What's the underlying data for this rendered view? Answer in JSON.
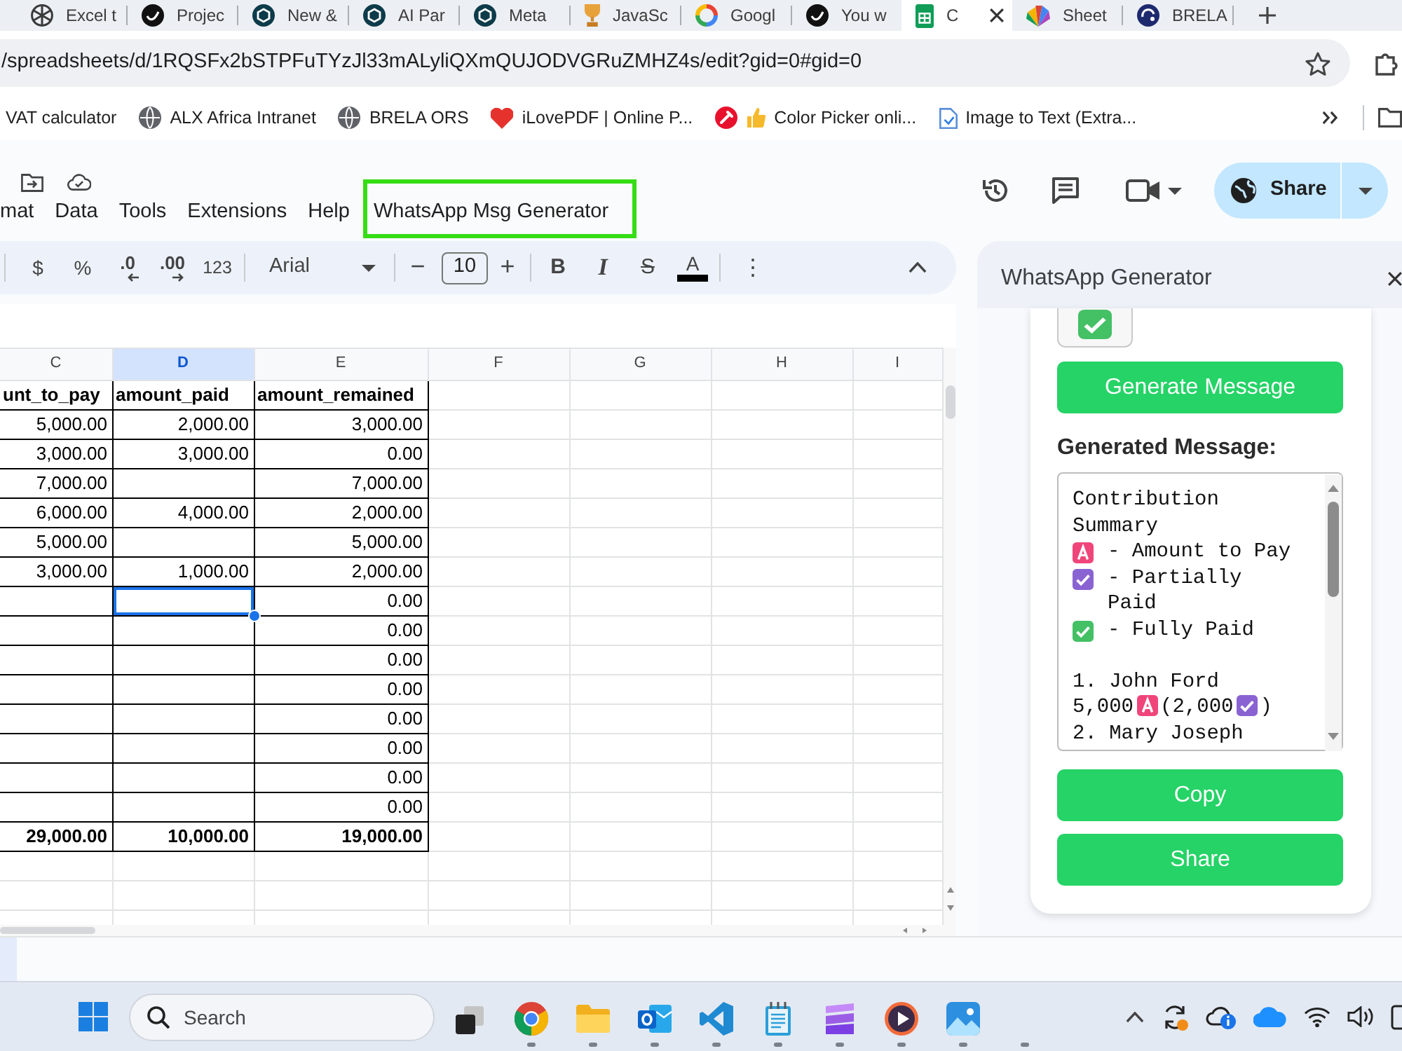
{
  "browser": {
    "tabs": [
      {
        "title": "Excel t",
        "kind": "knot",
        "selected": false
      },
      {
        "title": "Projec",
        "kind": "disc",
        "selected": false
      },
      {
        "title": "New &",
        "kind": "hexagon",
        "selected": false
      },
      {
        "title": "AI Par",
        "kind": "hexagon",
        "selected": false
      },
      {
        "title": "Meta",
        "kind": "hexagon",
        "selected": false
      },
      {
        "title": "JavaSc",
        "kind": "figure",
        "selected": false
      },
      {
        "title": "Googl",
        "kind": "ring",
        "selected": false
      },
      {
        "title": "You w",
        "kind": "disc",
        "selected": false
      },
      {
        "title": "C",
        "kind": "grid",
        "selected": true
      },
      {
        "title": "Sheet",
        "kind": "fan",
        "selected": false
      },
      {
        "title": "BRELA",
        "kind": "seal",
        "selected": false
      }
    ],
    "address": "/spreadsheets/d/1RQSFx2bSTPFuTYzJl33mALyliQXmQUJODVGRuZMHZ4s/edit?gid=0#gid=0",
    "bookmarks": [
      {
        "label": "VAT calculator"
      },
      {
        "label": "ALX Africa Intranet",
        "kind": "globe"
      },
      {
        "label": "BRELA ORS",
        "kind": "globe"
      },
      {
        "label": "iLovePDF | Online P...",
        "kind": "heart"
      },
      {
        "label": "Color Picker onli...",
        "kind": "picker"
      },
      {
        "label": "Image to Text (Extra...",
        "kind": "page"
      }
    ]
  },
  "sheets": {
    "menu": [
      {
        "label": "mat",
        "outlined": false
      },
      {
        "label": "Data",
        "outlined": false
      },
      {
        "label": "Tools",
        "outlined": false
      },
      {
        "label": "Extensions",
        "outlined": false
      },
      {
        "label": "Help",
        "outlined": false
      },
      {
        "label": "WhatsApp Msg Generator",
        "outlined": true
      }
    ],
    "share": "Share",
    "toolbar": {
      "currency": "$",
      "percent": "%",
      "decrease_decimals": ".0",
      "increase_decimals": ".00",
      "number_format": "123",
      "font": "Arial",
      "size_minus": "−",
      "font_size": "10",
      "size_plus": "+",
      "bold": "B",
      "italic": "I",
      "strikethrough": "S",
      "text_color": "A",
      "more": "⋮"
    },
    "columns": [
      {
        "label": "C",
        "selected": false
      },
      {
        "label": "D",
        "selected": true
      },
      {
        "label": "E",
        "selected": false
      },
      {
        "label": "F",
        "selected": false
      },
      {
        "label": "G",
        "selected": false
      },
      {
        "label": "H",
        "selected": false
      },
      {
        "label": "I",
        "selected": false
      }
    ],
    "rows": [
      {
        "kind": "header",
        "cells": [
          {
            "text": "unt_to_pay",
            "selected": false
          },
          {
            "text": "amount_paid",
            "selected": false
          },
          {
            "text": "amount_remained",
            "selected": false
          }
        ]
      },
      {
        "kind": "data",
        "cells": [
          {
            "text": "5,000.00",
            "selected": false
          },
          {
            "text": "2,000.00",
            "selected": false
          },
          {
            "text": "3,000.00",
            "selected": false
          }
        ]
      },
      {
        "kind": "data",
        "cells": [
          {
            "text": "3,000.00",
            "selected": false
          },
          {
            "text": "3,000.00",
            "selected": false
          },
          {
            "text": "0.00",
            "selected": false
          }
        ]
      },
      {
        "kind": "data",
        "cells": [
          {
            "text": "7,000.00",
            "selected": false
          },
          {
            "selected": false
          },
          {
            "text": "7,000.00",
            "selected": false
          }
        ]
      },
      {
        "kind": "data",
        "cells": [
          {
            "text": "6,000.00",
            "selected": false
          },
          {
            "text": "4,000.00",
            "selected": false
          },
          {
            "text": "2,000.00",
            "selected": false
          }
        ]
      },
      {
        "kind": "data",
        "cells": [
          {
            "text": "5,000.00",
            "selected": false
          },
          {
            "selected": false
          },
          {
            "text": "5,000.00",
            "selected": false
          }
        ]
      },
      {
        "kind": "data",
        "cells": [
          {
            "text": "3,000.00",
            "selected": false
          },
          {
            "text": "1,000.00",
            "selected": false
          },
          {
            "text": "2,000.00",
            "selected": false
          }
        ]
      },
      {
        "kind": "data",
        "cells": [
          {
            "selected": false
          },
          {
            "selected": true
          },
          {
            "text": "0.00",
            "selected": false
          }
        ]
      },
      {
        "kind": "data",
        "cells": [
          {
            "selected": false
          },
          {
            "selected": false
          },
          {
            "text": "0.00",
            "selected": false
          }
        ]
      },
      {
        "kind": "data",
        "cells": [
          {
            "selected": false
          },
          {
            "selected": false
          },
          {
            "text": "0.00",
            "selected": false
          }
        ]
      },
      {
        "kind": "data",
        "cells": [
          {
            "selected": false
          },
          {
            "selected": false
          },
          {
            "text": "0.00",
            "selected": false
          }
        ]
      },
      {
        "kind": "data",
        "cells": [
          {
            "selected": false
          },
          {
            "selected": false
          },
          {
            "text": "0.00",
            "selected": false
          }
        ]
      },
      {
        "kind": "data",
        "cells": [
          {
            "selected": false
          },
          {
            "selected": false
          },
          {
            "text": "0.00",
            "selected": false
          }
        ]
      },
      {
        "kind": "data",
        "cells": [
          {
            "selected": false
          },
          {
            "selected": false
          },
          {
            "text": "0.00",
            "selected": false
          }
        ]
      },
      {
        "kind": "data",
        "cells": [
          {
            "selected": false
          },
          {
            "selected": false
          },
          {
            "text": "0.00",
            "selected": false
          }
        ]
      },
      {
        "kind": "total",
        "cells": [
          {
            "text": "29,000.00",
            "selected": false
          },
          {
            "text": "10,000.00",
            "selected": false
          },
          {
            "text": "19,000.00",
            "selected": false
          }
        ]
      }
    ]
  },
  "sidebar": {
    "title": "WhatsApp Generator",
    "generate": "Generate Message",
    "output_label": "Generated Message:",
    "message": {
      "title": "Contribution Summary",
      "legend": [
        {
          "kind": "to_pay",
          "label": "- Amount to Pay"
        },
        {
          "kind": "partial",
          "label": "- Partially Paid"
        },
        {
          "kind": "paid",
          "label": "- Fully Paid"
        }
      ],
      "entries": [
        {
          "name": "1. John Ford",
          "segments": [
            {
              "kind": "text",
              "text": "5,000"
            },
            {
              "kind": "to_pay"
            },
            {
              "kind": "text",
              "text": "(2,000"
            },
            {
              "kind": "partial"
            },
            {
              "kind": "text",
              "text": ")"
            }
          ]
        },
        {
          "name": "2. Mary Joseph"
        }
      ]
    },
    "copy": "Copy",
    "share": "Share"
  },
  "taskbar": {
    "search": {
      "placeholder": "Search"
    },
    "apps": [
      {
        "kind": "wheel",
        "running": true
      },
      {
        "kind": "folder",
        "running": true
      },
      {
        "kind": "mail",
        "running": true
      },
      {
        "kind": "bracket",
        "running": true
      },
      {
        "kind": "notepad",
        "running": true
      },
      {
        "kind": "stack",
        "running": true
      },
      {
        "kind": "play",
        "running": true
      },
      {
        "kind": "picture",
        "running": true
      },
      {
        "kind": "empty",
        "running": true
      }
    ]
  }
}
